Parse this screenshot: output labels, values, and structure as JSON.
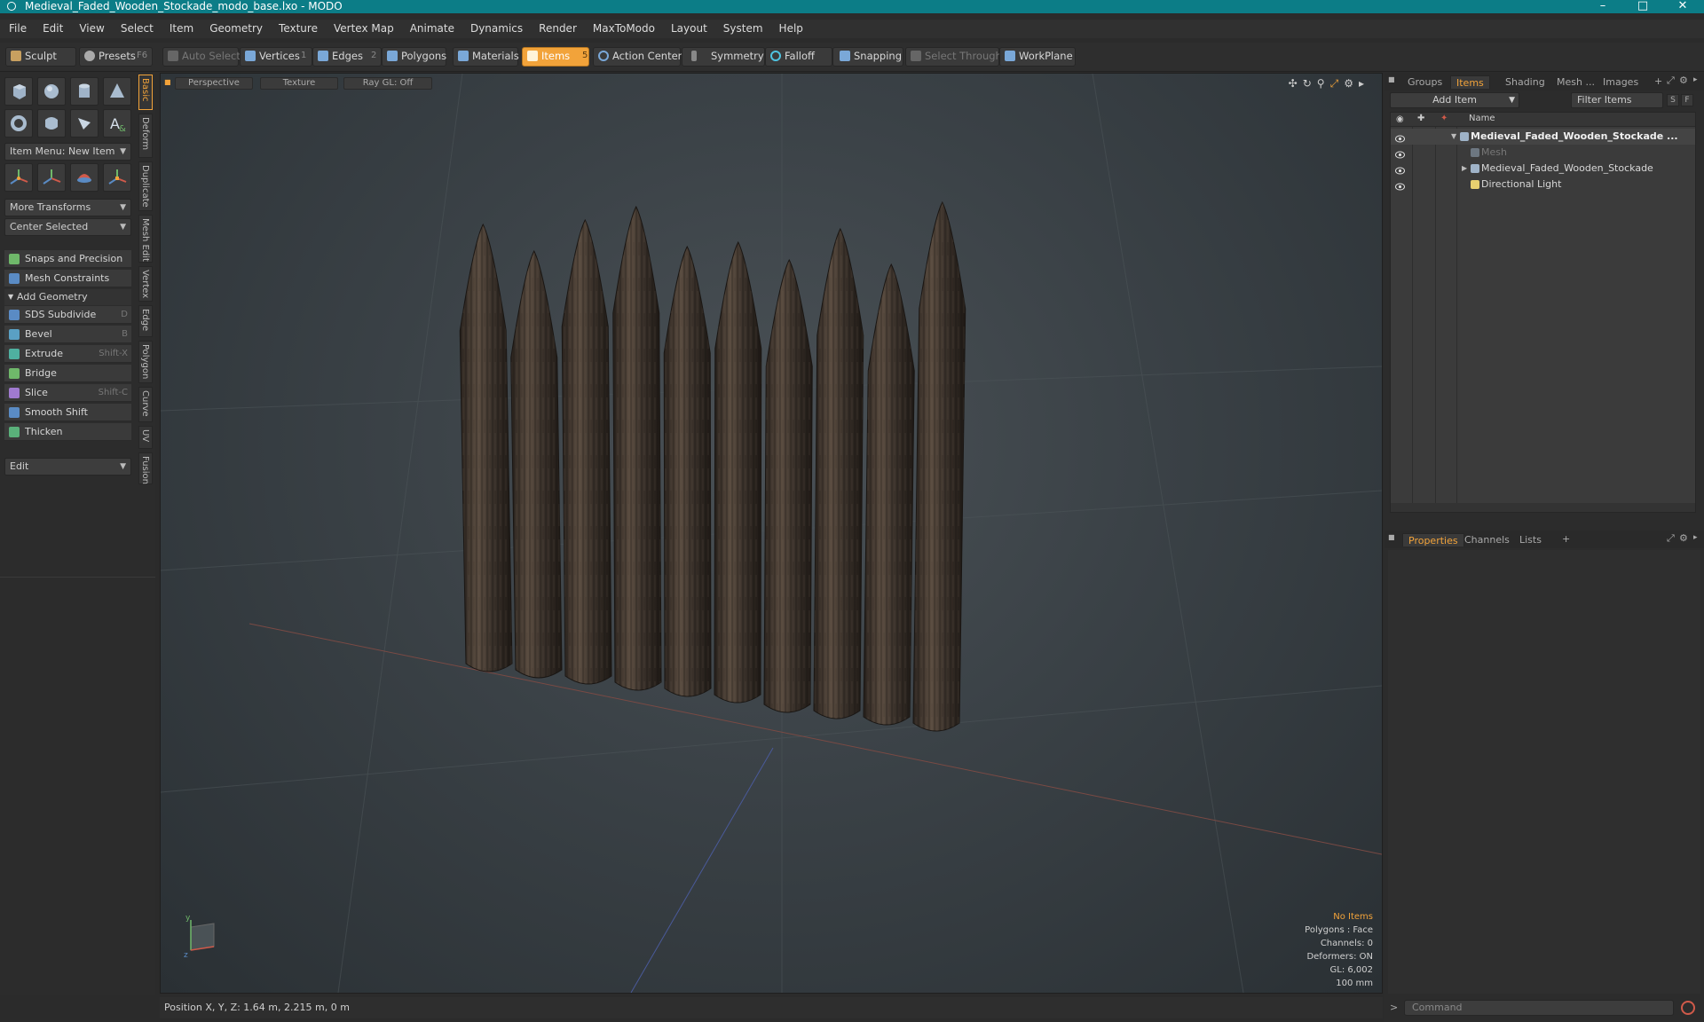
{
  "window": {
    "title": "Medieval_Faded_Wooden_Stockade_modo_base.lxo - MODO",
    "minimize": "–",
    "maximize": "□",
    "close": "✕"
  },
  "menu": [
    "File",
    "Edit",
    "View",
    "Select",
    "Item",
    "Geometry",
    "Texture",
    "Vertex Map",
    "Animate",
    "Dynamics",
    "Render",
    "MaxToModo",
    "Layout",
    "System",
    "Help"
  ],
  "toolbar": {
    "sculpt": "Sculpt",
    "presets": "Presets",
    "presets_key": "F6",
    "auto_select": "Auto Select",
    "vertices": "Vertices",
    "vertices_num": "1",
    "edges": "Edges",
    "edges_num": "2",
    "polygons": "Polygons",
    "materials": "Materials",
    "items": "Items",
    "items_num": "5",
    "action_center": "Action Center",
    "symmetry": "Symmetry",
    "falloff": "Falloff",
    "snapping": "Snapping",
    "select_through": "Select Through",
    "workplane": "WorkPlane"
  },
  "left": {
    "item_menu": "Item Menu: New Item",
    "more_transforms": "More Transforms",
    "center_selected": "Center Selected",
    "snaps": "Snaps and Precision",
    "mesh_constraints": "Mesh Constraints",
    "add_geometry": "Add Geometry",
    "tools": [
      {
        "label": "SDS Subdivide",
        "key": "D",
        "color": "#5a8bc4"
      },
      {
        "label": "Bevel",
        "key": "B",
        "color": "#5aa0c4"
      },
      {
        "label": "Extrude",
        "key": "Shift-X",
        "color": "#4fb0a0"
      },
      {
        "label": "Bridge",
        "key": "",
        "color": "#6fb86a"
      },
      {
        "label": "Slice",
        "key": "Shift-C",
        "color": "#a07ad0"
      },
      {
        "label": "Smooth Shift",
        "key": "",
        "color": "#5a8bc4"
      },
      {
        "label": "Thicken",
        "key": "",
        "color": "#5ab07a"
      }
    ],
    "edit": "Edit",
    "vtabs": [
      "Basic",
      "Deform",
      "Duplicate",
      "Mesh Edit",
      "Vertex",
      "Edge",
      "Polygon",
      "Curve",
      "UV",
      "Fusion"
    ]
  },
  "viewport": {
    "tabs": [
      "Perspective",
      "Texture",
      "Ray GL: Off"
    ],
    "hud": {
      "no_items": "No Items",
      "polygons": "Polygons : Face",
      "channels": "Channels: 0",
      "deformers": "Deformers: ON",
      "gl": "GL: 6,002",
      "scale": "100 mm"
    }
  },
  "right": {
    "top_tabs": [
      "Groups",
      "Items",
      "Shading",
      "Mesh ...",
      "Images"
    ],
    "add_item": "Add Item",
    "filter": "Filter Items",
    "filter_s": "S",
    "filter_f": "F",
    "col_name": "Name",
    "tree": [
      {
        "label": "Medieval_Faded_Wooden_Stockade ...",
        "bold": true,
        "indent": 0
      },
      {
        "label": "Mesh",
        "bold": false,
        "indent": 1,
        "dim": true
      },
      {
        "label": "Medieval_Faded_Wooden_Stockade",
        "bold": false,
        "indent": 1
      },
      {
        "label": "Directional Light",
        "bold": false,
        "indent": 1
      }
    ],
    "bottom_tabs": [
      "Properties",
      "Channels",
      "Lists"
    ],
    "command": "Command"
  },
  "status": {
    "position": "Position X, Y, Z:   1.64 m, 2.215 m, 0 m"
  },
  "colors": {
    "accent": "#f2a33a",
    "title_bg": "#0c7d87",
    "wood": "#4a3f36"
  },
  "scene": {
    "stake_count": 10
  }
}
